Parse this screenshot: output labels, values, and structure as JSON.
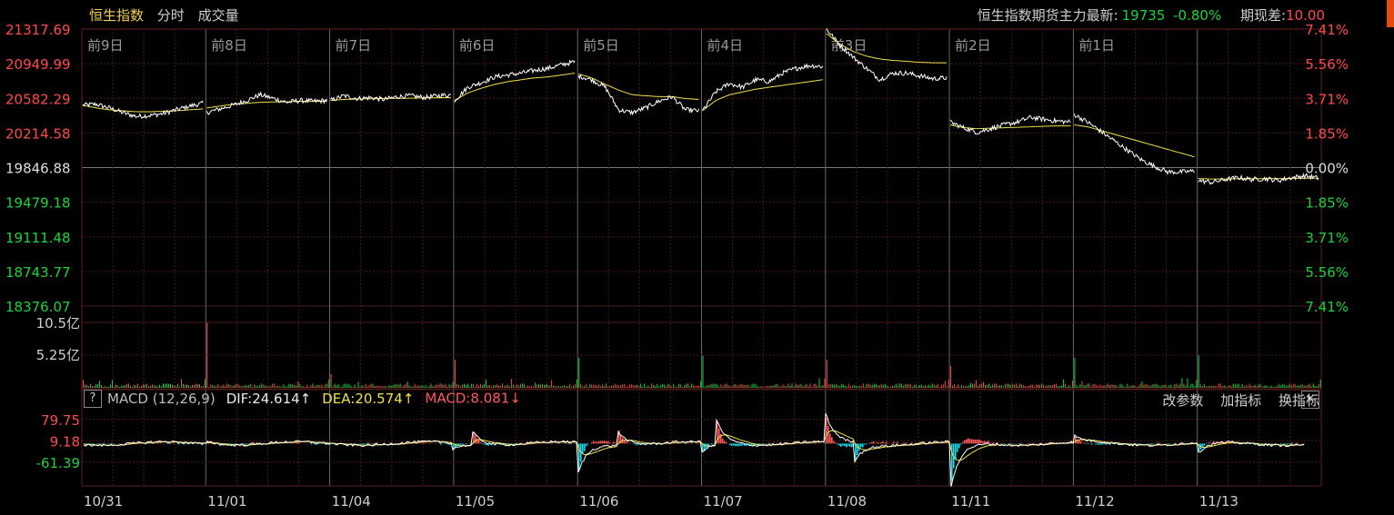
{
  "header": {
    "title": "恒生指数",
    "tabs": [
      "分时",
      "成交量"
    ],
    "futures_label": "恒生指数期货主力最新:",
    "futures_price": "19735",
    "futures_change": "-0.80%",
    "basis_label": "期现差:",
    "basis_value": "10.00"
  },
  "colors": {
    "up": "#ff4a4a",
    "down": "#19d43c",
    "price_line": "#ffffff",
    "avg_line": "#f0e04a",
    "grid": "#4a1a1a",
    "macd_pos": "#ff5a5a",
    "macd_neg": "#18d8e8"
  },
  "chart_data": [
    {
      "type": "line",
      "title": "",
      "day_labels": [
        "前9日",
        "前8日",
        "前7日",
        "前6日",
        "前5日",
        "前4日",
        "前3日",
        "前2日",
        "前1日",
        ""
      ],
      "x_dates": [
        "10/31",
        "11/01",
        "11/04",
        "11/05",
        "11/06",
        "11/07",
        "11/08",
        "11/11",
        "11/12",
        "11/13"
      ],
      "y_ticks_left": [
        "21317.69",
        "20949.99",
        "20582.29",
        "20214.58",
        "19846.88",
        "19479.18",
        "19111.48",
        "18743.77",
        "18376.07"
      ],
      "y_ticks_right": [
        "7.41%",
        "5.56%",
        "3.71%",
        "1.85%",
        "0.00%",
        "1.85%",
        "3.71%",
        "5.56%",
        "7.41%"
      ],
      "ylim": [
        18376.07,
        21317.69
      ],
      "reference": 19846.88,
      "series": [
        {
          "values_by_day": [
            [
              20510,
              20520,
              20480,
              20430,
              20390,
              20400,
              20420,
              20460,
              20500,
              20530
            ],
            [
              20430,
              20470,
              20510,
              20560,
              20620,
              20580,
              20540,
              20560,
              20550,
              20560
            ],
            [
              20560,
              20610,
              20580,
              20590,
              20570,
              20600,
              20610,
              20590,
              20610,
              20620
            ],
            [
              20560,
              20700,
              20750,
              20810,
              20830,
              20850,
              20880,
              20900,
              20940,
              20970
            ],
            [
              20820,
              20780,
              20700,
              20460,
              20430,
              20480,
              20550,
              20600,
              20460,
              20450
            ],
            [
              20450,
              20650,
              20740,
              20700,
              20780,
              20760,
              20850,
              20900,
              20930,
              20920
            ],
            [
              21320,
              21150,
              21020,
              20900,
              20780,
              20850,
              20850,
              20820,
              20790,
              20800
            ],
            [
              20330,
              20270,
              20220,
              20260,
              20300,
              20330,
              20380,
              20360,
              20340,
              20330
            ],
            [
              20410,
              20330,
              20230,
              20130,
              20030,
              19930,
              19860,
              19800,
              19800,
              19810
            ],
            [
              19710,
              19690,
              19720,
              19740,
              19720,
              19730,
              19710,
              19740,
              19760,
              19735
            ]
          ]
        },
        {
          "values_by_day": [
            [
              20510,
              20480,
              20460,
              20450,
              20440,
              20440,
              20445,
              20450,
              20460,
              20470
            ],
            [
              20480,
              20500,
              20520,
              20530,
              20540,
              20545,
              20545,
              20550,
              20550,
              20552
            ],
            [
              20560,
              20570,
              20575,
              20578,
              20580,
              20582,
              20584,
              20586,
              20588,
              20590
            ],
            [
              20560,
              20640,
              20690,
              20730,
              20760,
              20780,
              20800,
              20810,
              20830,
              20850
            ],
            [
              20840,
              20800,
              20730,
              20670,
              20620,
              20610,
              20600,
              20600,
              20580,
              20570
            ],
            [
              20450,
              20560,
              20620,
              20650,
              20680,
              20700,
              20720,
              20740,
              20760,
              20780
            ],
            [
              21270,
              21160,
              21080,
              21030,
              21000,
              20985,
              20975,
              20965,
              20960,
              20960
            ],
            [
              20300,
              20270,
              20260,
              20265,
              20270,
              20275,
              20280,
              20285,
              20290,
              20290
            ],
            [
              20300,
              20280,
              20240,
              20200,
              20160,
              20120,
              20080,
              20040,
              20000,
              19960
            ],
            [
              19730,
              19725,
              19725,
              19728,
              19728,
              19730,
              19730,
              19732,
              19733,
              19735
            ]
          ]
        }
      ]
    },
    {
      "type": "bar",
      "title": "",
      "y_ticks": [
        "10.5亿",
        "5.25亿"
      ],
      "ylim": [
        0,
        10.5
      ],
      "open_spike_by_day": [
        1.3,
        10.5,
        2.2,
        4.5,
        4.8,
        5.2,
        4.5,
        3.5,
        4.8,
        5.2
      ]
    },
    {
      "type": "line",
      "title": "MACD (12,26,9)",
      "dif_label": "DIF:24.614↑",
      "dea_label": "DEA:20.574↑",
      "macd_label": "MACD:8.081↓",
      "y_ticks": [
        "79.75",
        "9.18",
        "-61.39"
      ],
      "ylim": [
        -140,
        100
      ],
      "bar_spikes": [
        [
          227,
          14
        ],
        [
          362,
          10
        ],
        [
          498,
          -10
        ],
        [
          520,
          16
        ],
        [
          636,
          -40
        ],
        [
          680,
          22
        ],
        [
          772,
          -18
        ],
        [
          788,
          34
        ],
        [
          908,
          50
        ],
        [
          1046,
          -50
        ],
        [
          1182,
          12
        ],
        [
          1318,
          -14
        ]
      ],
      "dif_spikes": [
        [
          227,
          14
        ],
        [
          498,
          -20
        ],
        [
          520,
          44
        ],
        [
          636,
          -100
        ],
        [
          680,
          46
        ],
        [
          772,
          -32
        ],
        [
          788,
          82
        ],
        [
          908,
          92
        ],
        [
          940,
          -60
        ],
        [
          1046,
          -150
        ],
        [
          1182,
          20
        ],
        [
          1318,
          -36
        ]
      ],
      "buttons": [
        "改参数",
        "加指标",
        "换指标"
      ]
    }
  ]
}
